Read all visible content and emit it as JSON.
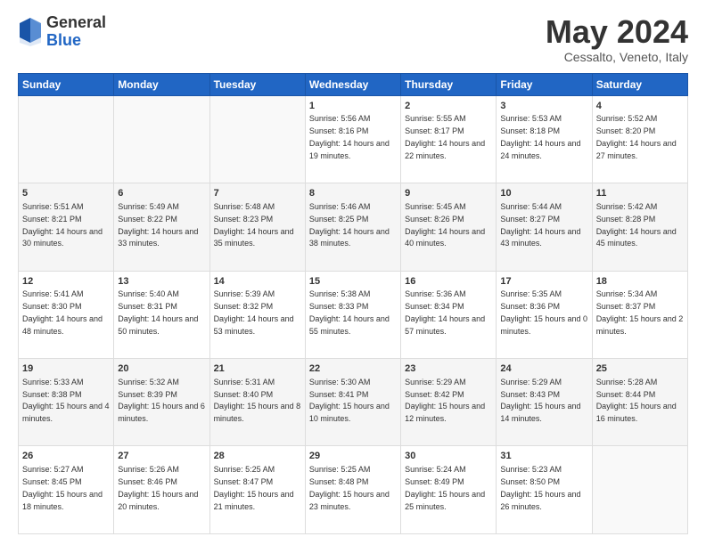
{
  "logo": {
    "general": "General",
    "blue": "Blue"
  },
  "title": "May 2024",
  "location": "Cessalto, Veneto, Italy",
  "header_days": [
    "Sunday",
    "Monday",
    "Tuesday",
    "Wednesday",
    "Thursday",
    "Friday",
    "Saturday"
  ],
  "weeks": [
    [
      {
        "day": "",
        "sunrise": "",
        "sunset": "",
        "daylight": ""
      },
      {
        "day": "",
        "sunrise": "",
        "sunset": "",
        "daylight": ""
      },
      {
        "day": "",
        "sunrise": "",
        "sunset": "",
        "daylight": ""
      },
      {
        "day": "1",
        "sunrise": "Sunrise: 5:56 AM",
        "sunset": "Sunset: 8:16 PM",
        "daylight": "Daylight: 14 hours and 19 minutes."
      },
      {
        "day": "2",
        "sunrise": "Sunrise: 5:55 AM",
        "sunset": "Sunset: 8:17 PM",
        "daylight": "Daylight: 14 hours and 22 minutes."
      },
      {
        "day": "3",
        "sunrise": "Sunrise: 5:53 AM",
        "sunset": "Sunset: 8:18 PM",
        "daylight": "Daylight: 14 hours and 24 minutes."
      },
      {
        "day": "4",
        "sunrise": "Sunrise: 5:52 AM",
        "sunset": "Sunset: 8:20 PM",
        "daylight": "Daylight: 14 hours and 27 minutes."
      }
    ],
    [
      {
        "day": "5",
        "sunrise": "Sunrise: 5:51 AM",
        "sunset": "Sunset: 8:21 PM",
        "daylight": "Daylight: 14 hours and 30 minutes."
      },
      {
        "day": "6",
        "sunrise": "Sunrise: 5:49 AM",
        "sunset": "Sunset: 8:22 PM",
        "daylight": "Daylight: 14 hours and 33 minutes."
      },
      {
        "day": "7",
        "sunrise": "Sunrise: 5:48 AM",
        "sunset": "Sunset: 8:23 PM",
        "daylight": "Daylight: 14 hours and 35 minutes."
      },
      {
        "day": "8",
        "sunrise": "Sunrise: 5:46 AM",
        "sunset": "Sunset: 8:25 PM",
        "daylight": "Daylight: 14 hours and 38 minutes."
      },
      {
        "day": "9",
        "sunrise": "Sunrise: 5:45 AM",
        "sunset": "Sunset: 8:26 PM",
        "daylight": "Daylight: 14 hours and 40 minutes."
      },
      {
        "day": "10",
        "sunrise": "Sunrise: 5:44 AM",
        "sunset": "Sunset: 8:27 PM",
        "daylight": "Daylight: 14 hours and 43 minutes."
      },
      {
        "day": "11",
        "sunrise": "Sunrise: 5:42 AM",
        "sunset": "Sunset: 8:28 PM",
        "daylight": "Daylight: 14 hours and 45 minutes."
      }
    ],
    [
      {
        "day": "12",
        "sunrise": "Sunrise: 5:41 AM",
        "sunset": "Sunset: 8:30 PM",
        "daylight": "Daylight: 14 hours and 48 minutes."
      },
      {
        "day": "13",
        "sunrise": "Sunrise: 5:40 AM",
        "sunset": "Sunset: 8:31 PM",
        "daylight": "Daylight: 14 hours and 50 minutes."
      },
      {
        "day": "14",
        "sunrise": "Sunrise: 5:39 AM",
        "sunset": "Sunset: 8:32 PM",
        "daylight": "Daylight: 14 hours and 53 minutes."
      },
      {
        "day": "15",
        "sunrise": "Sunrise: 5:38 AM",
        "sunset": "Sunset: 8:33 PM",
        "daylight": "Daylight: 14 hours and 55 minutes."
      },
      {
        "day": "16",
        "sunrise": "Sunrise: 5:36 AM",
        "sunset": "Sunset: 8:34 PM",
        "daylight": "Daylight: 14 hours and 57 minutes."
      },
      {
        "day": "17",
        "sunrise": "Sunrise: 5:35 AM",
        "sunset": "Sunset: 8:36 PM",
        "daylight": "Daylight: 15 hours and 0 minutes."
      },
      {
        "day": "18",
        "sunrise": "Sunrise: 5:34 AM",
        "sunset": "Sunset: 8:37 PM",
        "daylight": "Daylight: 15 hours and 2 minutes."
      }
    ],
    [
      {
        "day": "19",
        "sunrise": "Sunrise: 5:33 AM",
        "sunset": "Sunset: 8:38 PM",
        "daylight": "Daylight: 15 hours and 4 minutes."
      },
      {
        "day": "20",
        "sunrise": "Sunrise: 5:32 AM",
        "sunset": "Sunset: 8:39 PM",
        "daylight": "Daylight: 15 hours and 6 minutes."
      },
      {
        "day": "21",
        "sunrise": "Sunrise: 5:31 AM",
        "sunset": "Sunset: 8:40 PM",
        "daylight": "Daylight: 15 hours and 8 minutes."
      },
      {
        "day": "22",
        "sunrise": "Sunrise: 5:30 AM",
        "sunset": "Sunset: 8:41 PM",
        "daylight": "Daylight: 15 hours and 10 minutes."
      },
      {
        "day": "23",
        "sunrise": "Sunrise: 5:29 AM",
        "sunset": "Sunset: 8:42 PM",
        "daylight": "Daylight: 15 hours and 12 minutes."
      },
      {
        "day": "24",
        "sunrise": "Sunrise: 5:29 AM",
        "sunset": "Sunset: 8:43 PM",
        "daylight": "Daylight: 15 hours and 14 minutes."
      },
      {
        "day": "25",
        "sunrise": "Sunrise: 5:28 AM",
        "sunset": "Sunset: 8:44 PM",
        "daylight": "Daylight: 15 hours and 16 minutes."
      }
    ],
    [
      {
        "day": "26",
        "sunrise": "Sunrise: 5:27 AM",
        "sunset": "Sunset: 8:45 PM",
        "daylight": "Daylight: 15 hours and 18 minutes."
      },
      {
        "day": "27",
        "sunrise": "Sunrise: 5:26 AM",
        "sunset": "Sunset: 8:46 PM",
        "daylight": "Daylight: 15 hours and 20 minutes."
      },
      {
        "day": "28",
        "sunrise": "Sunrise: 5:25 AM",
        "sunset": "Sunset: 8:47 PM",
        "daylight": "Daylight: 15 hours and 21 minutes."
      },
      {
        "day": "29",
        "sunrise": "Sunrise: 5:25 AM",
        "sunset": "Sunset: 8:48 PM",
        "daylight": "Daylight: 15 hours and 23 minutes."
      },
      {
        "day": "30",
        "sunrise": "Sunrise: 5:24 AM",
        "sunset": "Sunset: 8:49 PM",
        "daylight": "Daylight: 15 hours and 25 minutes."
      },
      {
        "day": "31",
        "sunrise": "Sunrise: 5:23 AM",
        "sunset": "Sunset: 8:50 PM",
        "daylight": "Daylight: 15 hours and 26 minutes."
      },
      {
        "day": "",
        "sunrise": "",
        "sunset": "",
        "daylight": ""
      }
    ]
  ]
}
